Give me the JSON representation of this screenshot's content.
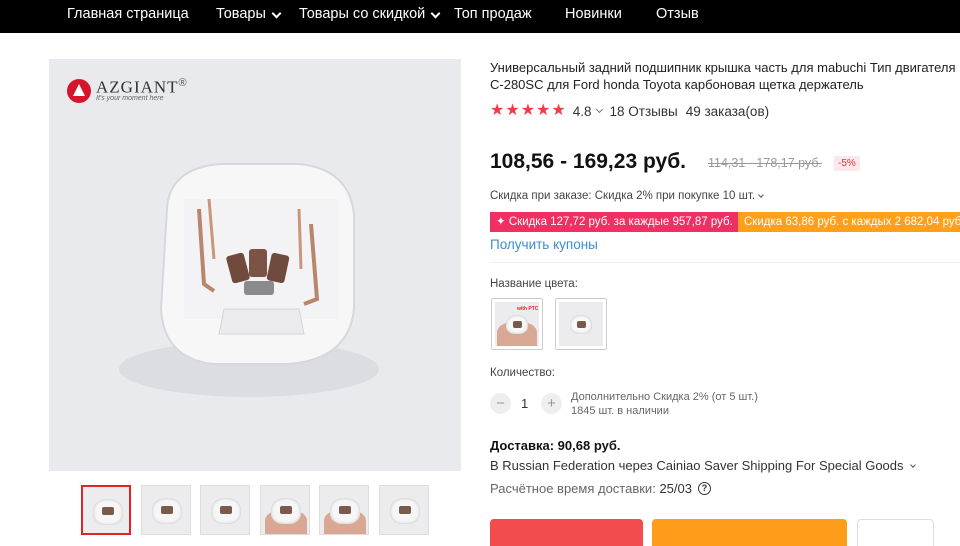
{
  "nav": {
    "items": [
      {
        "label": "Главная страница",
        "dropdown": false
      },
      {
        "label": "Товары",
        "dropdown": true
      },
      {
        "label": "Товары со скидкой",
        "dropdown": true
      },
      {
        "label": "Топ продаж",
        "dropdown": false
      },
      {
        "label": "Новинки",
        "dropdown": false
      },
      {
        "label": "Отзыв",
        "dropdown": false
      }
    ]
  },
  "gallery": {
    "brand_name": "AZGIANT",
    "brand_reg": "®",
    "brand_tagline": "It's your moment here",
    "thumbnails_count": 6,
    "active_thumbnail": 1
  },
  "product": {
    "title_line1": "Универсальный задний подшипник крышка часть для mabuchi Тип двигателя",
    "title_line2": "C-280SC для Ford honda Toyota карбоновая щетка держатель",
    "rating": "4.8",
    "stars": 5,
    "reviews": "18 Отзывы",
    "orders": "49 заказа(ов)"
  },
  "pricing": {
    "price": "108,56 - 169,23 руб.",
    "old_price": "114,31 - 178,17 руб.",
    "discount": "-5%",
    "order_discount": "Скидка при заказе: Скидка 2% при покупке 10 шт.",
    "coupon_1": "✦ Скидка 127,72 руб. за каждые 957,87 руб.",
    "coupon_2": "Скидка 63,86 руб. с каждых 2 682,04 руб.",
    "get_coupons": "Получить купоны"
  },
  "options": {
    "color_label": "Название цвета:",
    "swatch_1_tag": "with PTC"
  },
  "quantity": {
    "label": "Количество:",
    "minus": "−",
    "value": "1",
    "plus": "+",
    "extra_discount": "Дополнительно Скидка 2% (от 5 шт.)",
    "stock": "1845 шт. в наличии"
  },
  "shipping": {
    "title": "Доставка: 90,68 руб.",
    "route": "В Russian Federation через Cainiao Saver Shipping For Special Goods",
    "eta_label": "Расчётное время доставки:",
    "eta_value": "25/03",
    "help_icon": "?"
  },
  "colors": {
    "nav_bg": "#000000",
    "price_red": "#e62e3e",
    "coupon_pink": "#f02f63",
    "coupon_orange": "#ff9f1c",
    "link_blue": "#3a8dd0",
    "star": "#ee3c4a"
  }
}
